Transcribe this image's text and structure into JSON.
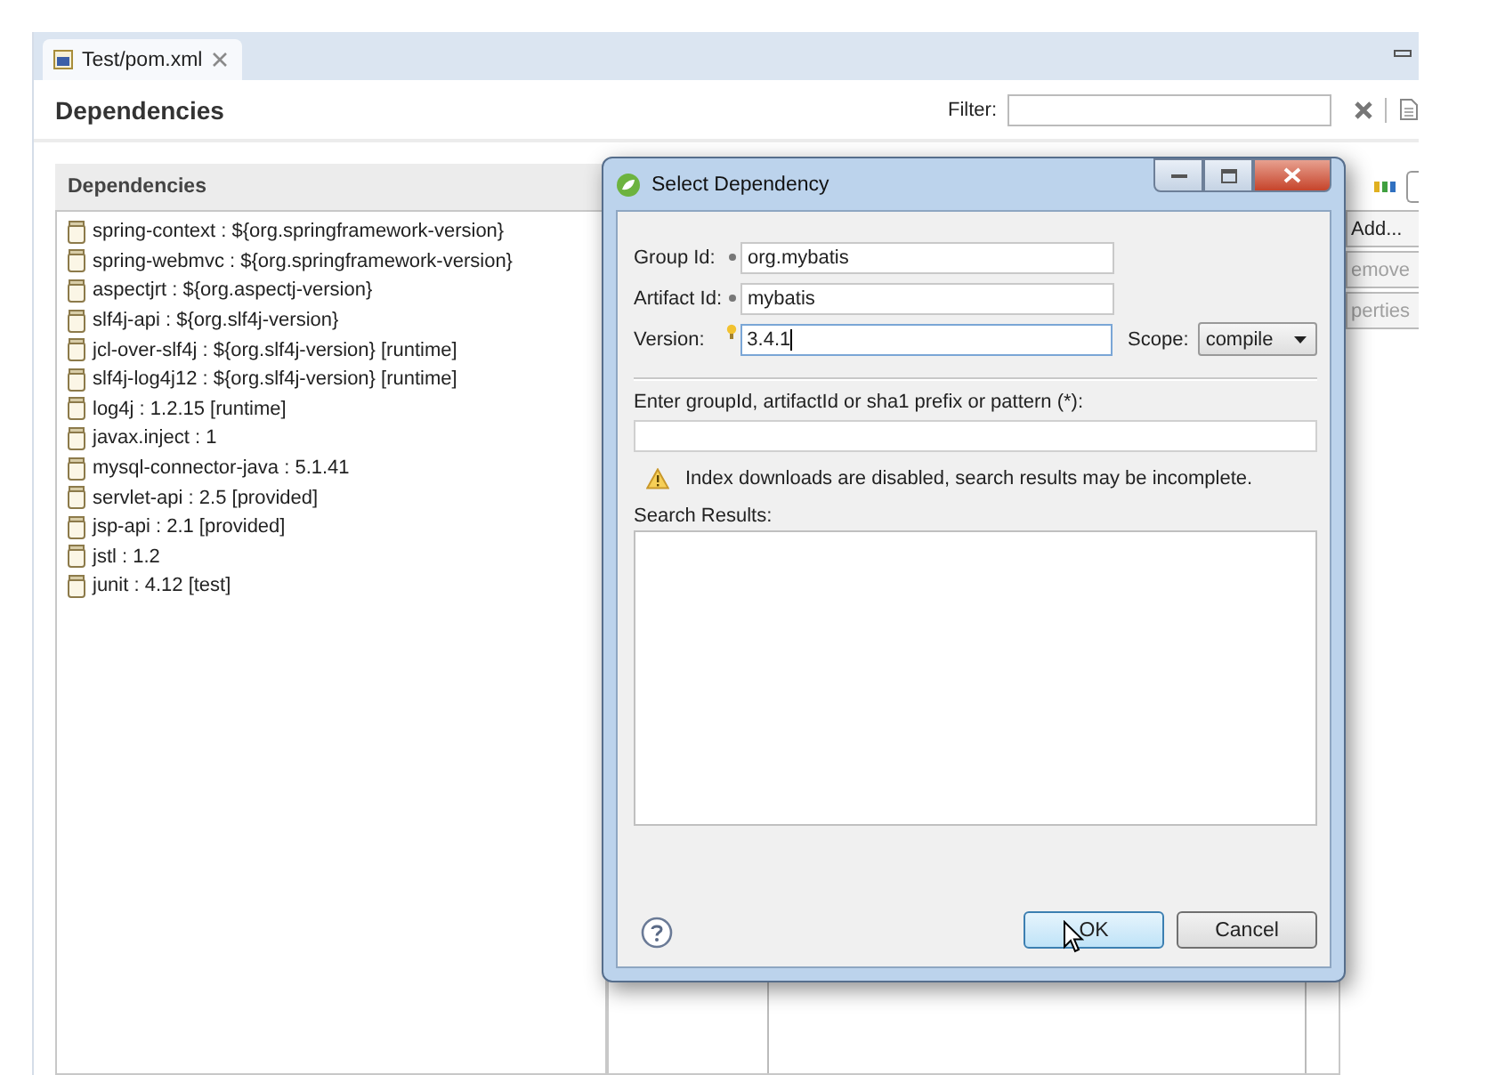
{
  "editor_tab": {
    "label": "Test/pom.xml",
    "selected": true
  },
  "page_title": "Dependencies",
  "filter_label": "Filter:",
  "dependencies_panel": {
    "title": "Dependencies",
    "items": [
      {
        "label": "spring-context : ${org.springframework-version}"
      },
      {
        "label": "spring-webmvc : ${org.springframework-version}"
      },
      {
        "label": "aspectjrt : ${org.aspectj-version}"
      },
      {
        "label": "slf4j-api : ${org.slf4j-version}"
      },
      {
        "label": "jcl-over-slf4j : ${org.slf4j-version} [runtime]"
      },
      {
        "label": "slf4j-log4j12 : ${org.slf4j-version} [runtime]"
      },
      {
        "label": "log4j : 1.2.15 [runtime]"
      },
      {
        "label": "javax.inject : 1"
      },
      {
        "label": "mysql-connector-java : 5.1.41"
      },
      {
        "label": "servlet-api : 2.5 [provided]"
      },
      {
        "label": "jsp-api : 2.1 [provided]"
      },
      {
        "label": "jstl : 1.2"
      },
      {
        "label": "junit : 4.12 [test]"
      }
    ]
  },
  "side_buttons": [
    {
      "label": "Add...",
      "disabled": false
    },
    {
      "label": "emove",
      "disabled": true
    },
    {
      "label": "perties",
      "disabled": true
    }
  ],
  "dialog": {
    "title": "Select Dependency",
    "fields": [
      {
        "label": "Group Id:",
        "value": "org.mybatis",
        "required": true,
        "hint": false,
        "focused": false
      },
      {
        "label": "Artifact Id:",
        "value": "mybatis",
        "required": true,
        "hint": false,
        "focused": false
      },
      {
        "label": "Version:",
        "value": "3.4.1",
        "required": false,
        "hint": true,
        "focused": true
      }
    ],
    "scope": {
      "label": "Scope:",
      "value": "compile"
    },
    "query_label": "Enter groupId, artifactId or sha1 prefix or pattern (*):",
    "warning": "Index downloads are disabled, search results may be incomplete.",
    "results_label": "Search Results:",
    "buttons": [
      {
        "label": "OK",
        "default": true
      },
      {
        "label": "Cancel",
        "default": false
      }
    ]
  }
}
